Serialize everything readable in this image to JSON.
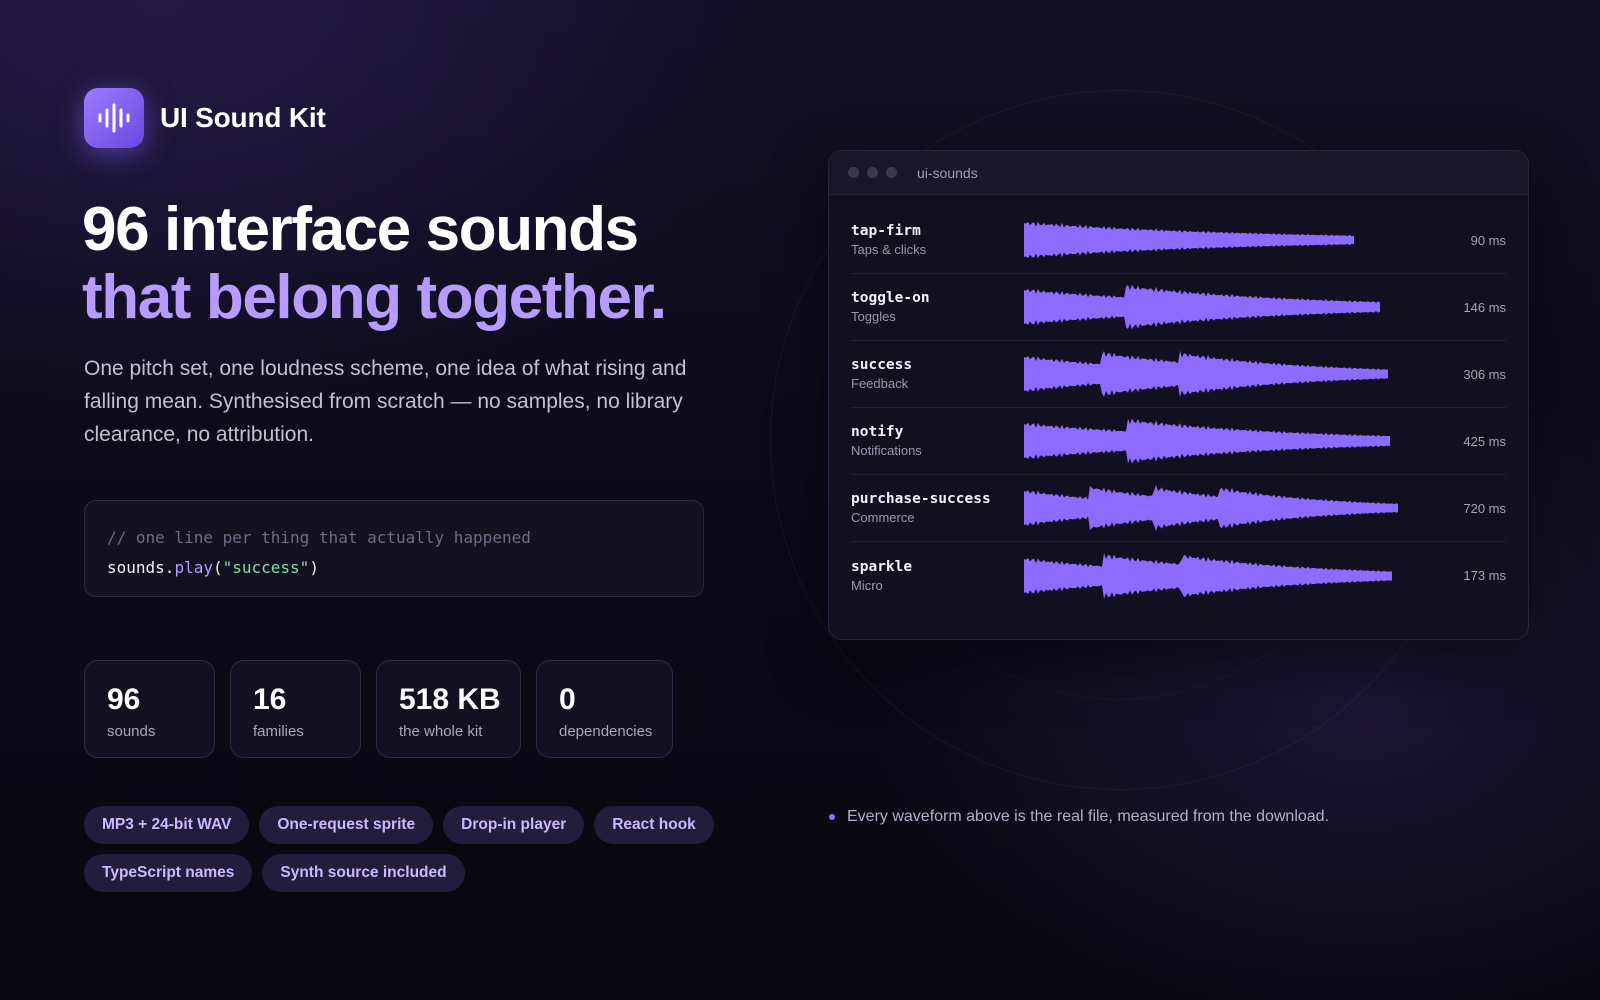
{
  "brand": {
    "name": "UI Sound Kit",
    "logo_icon": "waveform-icon",
    "accent": "#8b6cff"
  },
  "hero": {
    "headline_line1": "96 interface sounds",
    "headline_line2": "that belong together.",
    "lead": "One pitch set, one loudness scheme, one idea of what rising and falling mean. Synthesised from scratch — no samples, no library clearance, no attribution."
  },
  "code": {
    "comment": "// one line per thing that actually happened",
    "object": "sounds",
    "dot": ".",
    "method": "play",
    "open": "(",
    "arg": "\"success\"",
    "close": ")"
  },
  "stats": [
    {
      "value": "96",
      "label": "sounds"
    },
    {
      "value": "16",
      "label": "families"
    },
    {
      "value": "518 KB",
      "label": "the whole kit"
    },
    {
      "value": "0",
      "label": "dependencies"
    }
  ],
  "features": [
    "MP3 + 24-bit WAV",
    "One-request sprite",
    "Drop-in player",
    "React hook",
    "TypeScript names",
    "Synth source included"
  ],
  "player": {
    "window_title": "ui-sounds",
    "waveform_color": "#8b6cff",
    "sounds": [
      {
        "name": "tap-firm",
        "family": "Taps & clicks",
        "duration": "90 ms",
        "hits": 1
      },
      {
        "name": "toggle-on",
        "family": "Toggles",
        "duration": "146 ms",
        "hits": 2
      },
      {
        "name": "success",
        "family": "Feedback",
        "duration": "306 ms",
        "hits": 3
      },
      {
        "name": "notify",
        "family": "Notifications",
        "duration": "425 ms",
        "hits": 2
      },
      {
        "name": "purchase-success",
        "family": "Commerce",
        "duration": "720 ms",
        "hits": 4
      },
      {
        "name": "sparkle",
        "family": "Micro",
        "duration": "173 ms",
        "hits": 3
      }
    ]
  },
  "footnote": "Every waveform above is the real file, measured from the download."
}
